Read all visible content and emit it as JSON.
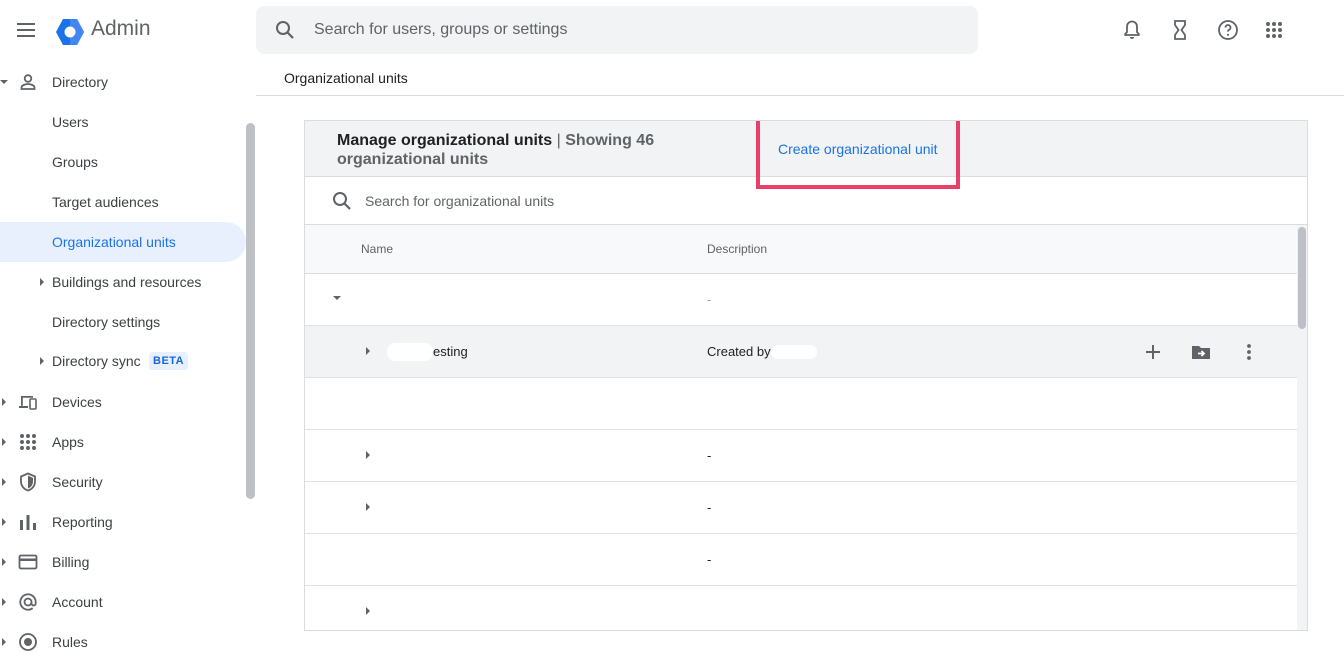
{
  "app": {
    "title": "Admin",
    "logo": "admin-hexagon-logo"
  },
  "search": {
    "placeholder": "Search for users, groups or settings"
  },
  "header_icons": [
    "bell-icon",
    "hourglass-icon",
    "help-icon",
    "apps-grid-icon"
  ],
  "breadcrumb": {
    "current": "Organizational units"
  },
  "sidebar": {
    "items": [
      {
        "label": "Directory",
        "icon": "person-icon",
        "expanded": true
      },
      {
        "label": "Users"
      },
      {
        "label": "Groups"
      },
      {
        "label": "Target audiences"
      },
      {
        "label": "Organizational units",
        "active": true
      },
      {
        "label": "Buildings and resources",
        "collapsible": true
      },
      {
        "label": "Directory settings"
      },
      {
        "label": "Directory sync",
        "badge": "BETA",
        "collapsible": true
      },
      {
        "label": "Devices",
        "icon": "devices-icon"
      },
      {
        "label": "Apps",
        "icon": "apps-icon"
      },
      {
        "label": "Security",
        "icon": "shield-icon"
      },
      {
        "label": "Reporting",
        "icon": "bar-chart-icon"
      },
      {
        "label": "Billing",
        "icon": "credit-card-icon"
      },
      {
        "label": "Account",
        "icon": "at-sign-icon"
      },
      {
        "label": "Rules",
        "icon": "rules-icon"
      }
    ]
  },
  "card": {
    "title": "Manage organizational units",
    "separator": " | ",
    "subtitle_line1": "Showing 46",
    "subtitle_line2": "organizational units",
    "create_link": "Create organizational unit",
    "search_placeholder": "Search for organizational units",
    "columns": {
      "name": "Name",
      "description": "Description"
    },
    "rows": [
      {
        "name": "",
        "description": "-",
        "caret": "down"
      },
      {
        "name": "esting",
        "description": "Created by",
        "caret": "right",
        "hover": true
      },
      {
        "name": "",
        "description": "",
        "caret": "none"
      },
      {
        "name": "",
        "description": "-",
        "caret": "right"
      },
      {
        "name": "",
        "description": "-",
        "caret": "right"
      },
      {
        "name": "",
        "description": "-",
        "caret": "none"
      },
      {
        "name": "",
        "description": "",
        "caret": "right"
      }
    ],
    "row_actions": [
      "add-icon",
      "move-folder-icon",
      "more-vert-icon"
    ]
  },
  "colors": {
    "accent": "#1a73e8",
    "highlight": "#e8406a",
    "active_bg": "#e8f0fe"
  }
}
